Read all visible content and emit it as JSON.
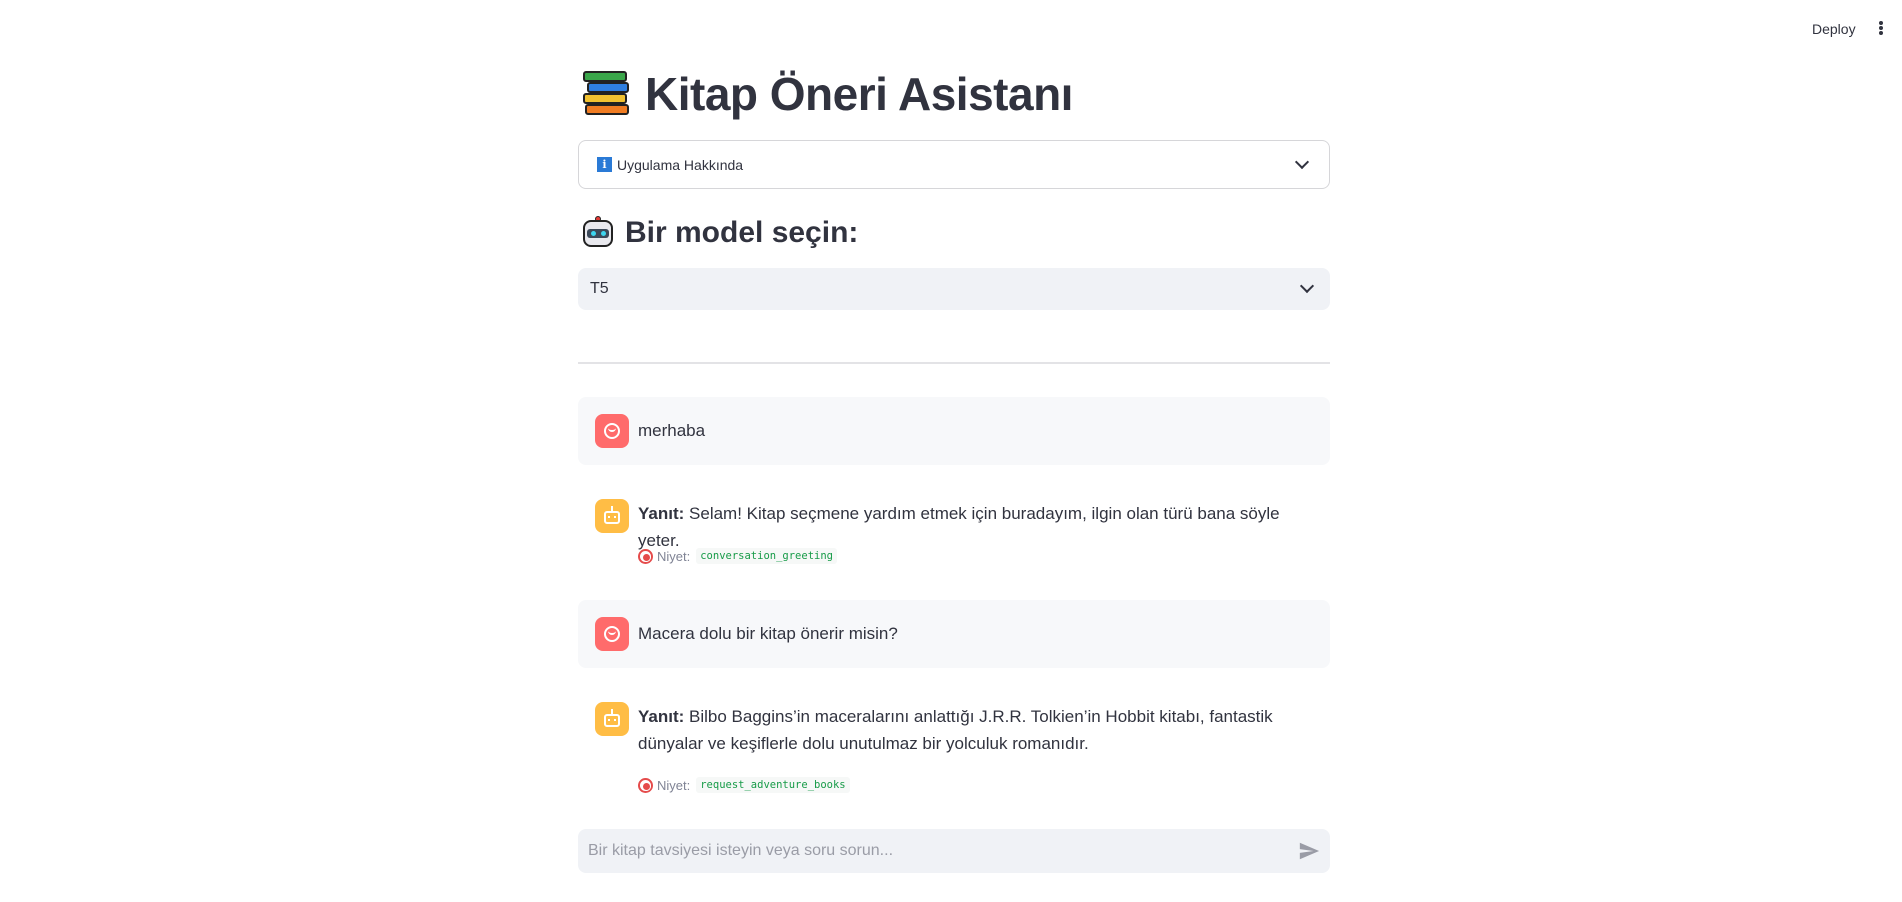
{
  "topbar": {
    "deploy_label": "Deploy",
    "menu_icon": "kebab-menu-icon"
  },
  "header": {
    "title": "Kitap Öneri Asistanı",
    "icon": "books-icon"
  },
  "about_expander": {
    "label": "Uygulama Hakkında",
    "icon": "info-icon"
  },
  "model_section": {
    "heading": "Bir model seçin:",
    "icon": "robot-icon"
  },
  "model_select": {
    "value": "T5"
  },
  "messages": [
    {
      "role": "user",
      "text": "merhaba"
    },
    {
      "role": "assistant",
      "prefix": "Yanıt:",
      "text": "Selam! Kitap seçmene yardım etmek için buradayım, ilgin olan türü bana söyle yeter.",
      "intent_label": "Niyet:",
      "intent": "conversation_greeting"
    },
    {
      "role": "user",
      "text": "Macera dolu bir kitap önerir misin?"
    },
    {
      "role": "assistant",
      "prefix": "Yanıt:",
      "text": "Bilbo Baggins’in maceralarını anlattığı J.R.R. Tolkien’in Hobbit kitabı, fantastik dünyalar ve keşiflerle dolu unutulmaz bir yolculuk romanıdır.",
      "intent_label": "Niyet:",
      "intent": "request_adventure_books"
    }
  ],
  "chat_input": {
    "placeholder": "Bir kitap tavsiyesi isteyin veya soru sorun..."
  },
  "colors": {
    "user_avatar": "#ff6b6b",
    "bot_avatar": "#ffbd45",
    "intent_code": "#179b48"
  }
}
